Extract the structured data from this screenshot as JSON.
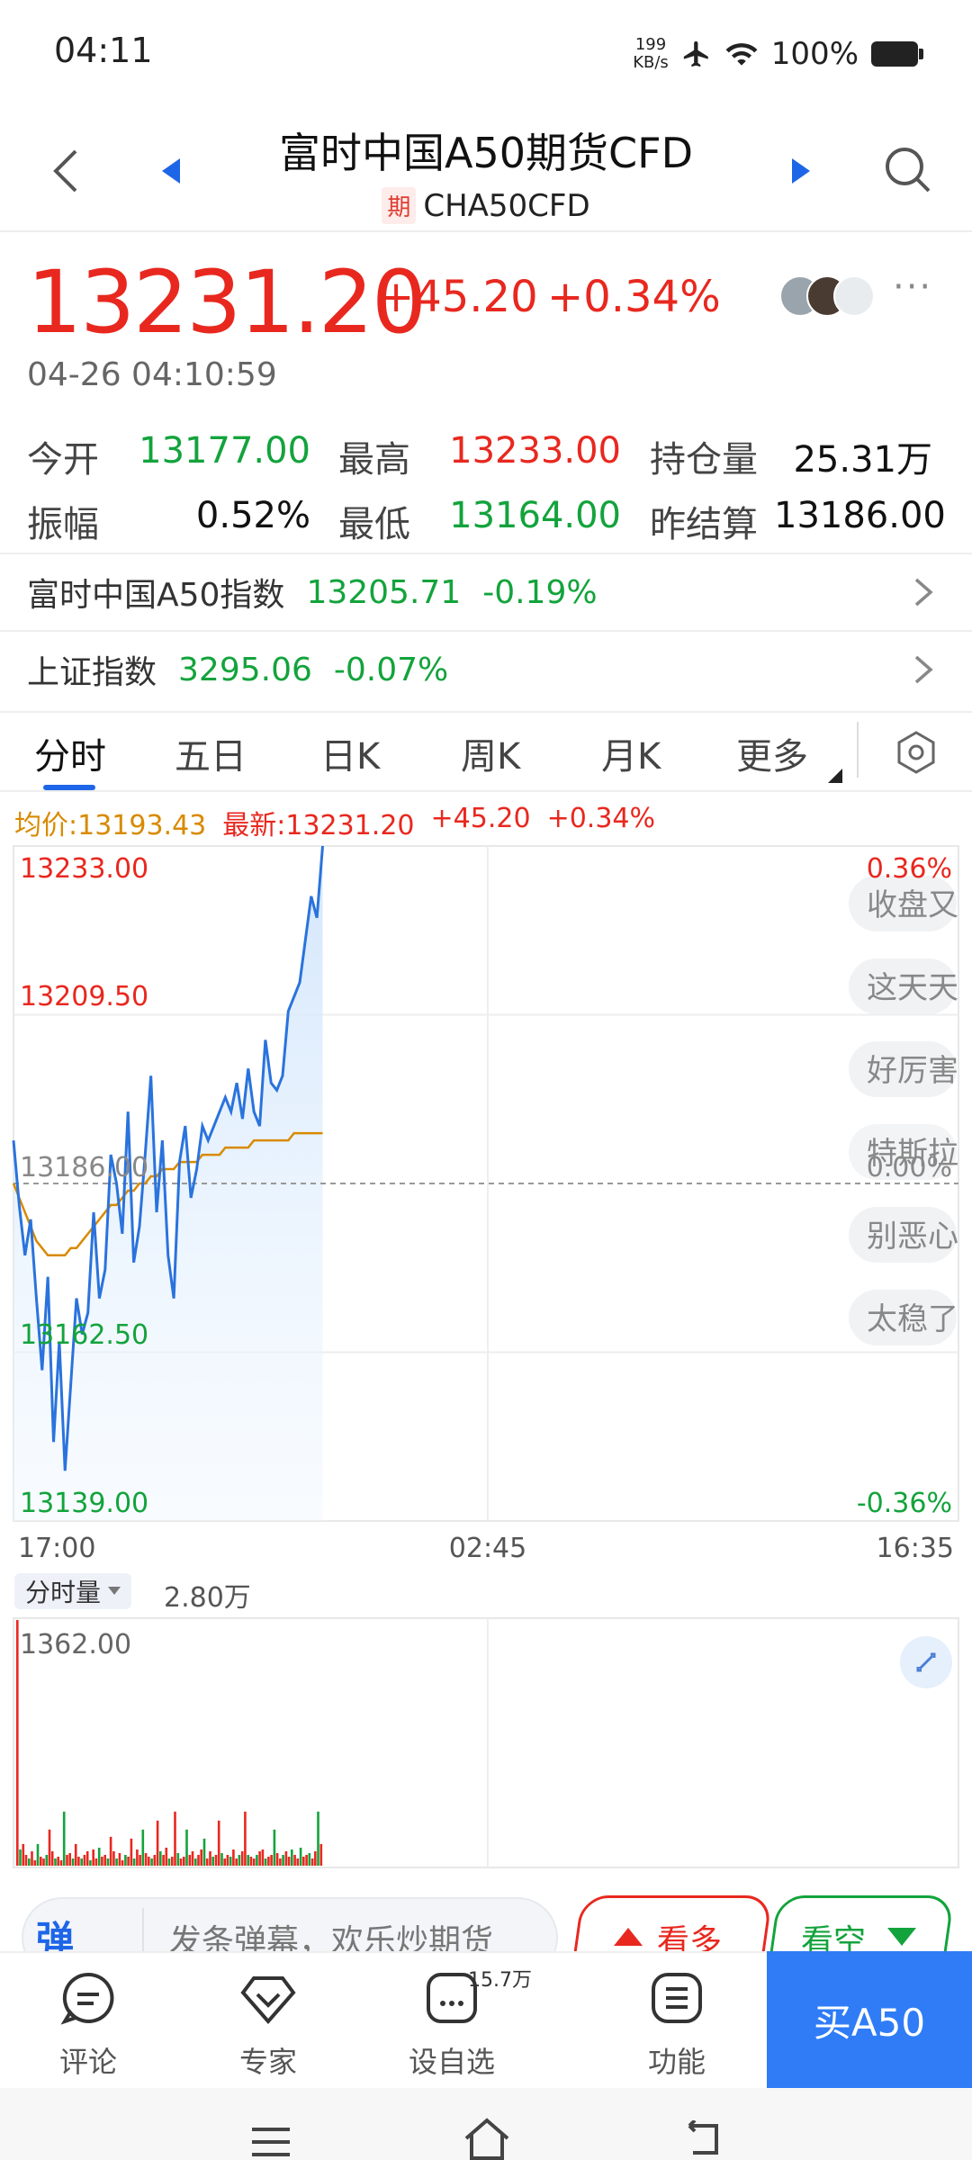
{
  "status": {
    "time": "04:11",
    "net_speed_value": "199",
    "net_speed_unit": "KB/s",
    "battery": "100%"
  },
  "header": {
    "title": "富时中国A50期货CFD",
    "badge": "期",
    "code": "CHA50CFD"
  },
  "quote": {
    "price": "13231.20",
    "change": "+45.20",
    "change_pct": "+0.34%",
    "time": "04-26 04:10:59",
    "more": "···"
  },
  "stats": [
    {
      "label": "今开",
      "value": "13177.00",
      "color": "green"
    },
    {
      "label": "最高",
      "value": "13233.00",
      "color": "red"
    },
    {
      "label": "持仓量",
      "value": "25.31万",
      "color": "black"
    },
    {
      "label": "振幅",
      "value": "0.52%",
      "color": "black"
    },
    {
      "label": "最低",
      "value": "13164.00",
      "color": "green"
    },
    {
      "label": "昨结算",
      "value": "13186.00",
      "color": "black"
    }
  ],
  "indices": [
    {
      "name": "富时中国A50指数",
      "value": "13205.71",
      "pct": "-0.19%"
    },
    {
      "name": "上证指数",
      "value": "3295.06",
      "pct": "-0.07%"
    }
  ],
  "tabs": [
    {
      "label": "分时"
    },
    {
      "label": "五日"
    },
    {
      "label": "日K"
    },
    {
      "label": "周K"
    },
    {
      "label": "月K"
    },
    {
      "label": "更多"
    }
  ],
  "chart_info": {
    "avg": "均价:13193.43",
    "latest": "最新:13231.20",
    "change": "+45.20",
    "pct": "+0.34%"
  },
  "chart_data": {
    "type": "line",
    "y_ticks": [
      "13233.00",
      "13209.50",
      "13186.00",
      "13162.50",
      "13139.00"
    ],
    "pct_ticks": [
      "0.36%",
      "0.00%",
      "-0.36%"
    ],
    "x_ticks": [
      "17:00",
      "02:45",
      "16:35"
    ],
    "ylim": [
      13139,
      13233
    ],
    "reference": 13186,
    "price": [
      13192,
      13183,
      13176,
      13181,
      13170,
      13160,
      13173,
      13150,
      13164,
      13146,
      13158,
      13170,
      13165,
      13168,
      13182,
      13170,
      13174,
      13190,
      13186,
      13179,
      13196,
      13175,
      13180,
      13190,
      13201,
      13182,
      13192,
      13176,
      13170,
      13189,
      13194,
      13184,
      13188,
      13194,
      13192,
      13194,
      13196,
      13198,
      13196,
      13200,
      13195,
      13202,
      13196,
      13194,
      13206,
      13200,
      13199,
      13201,
      13210,
      13212,
      13214,
      13220,
      13226,
      13223,
      13233
    ],
    "avg": [
      13186,
      13184,
      13182,
      13180,
      13178,
      13177,
      13176,
      13176,
      13176,
      13176,
      13177,
      13177,
      13178,
      13179,
      13180,
      13181,
      13182,
      13183,
      13183,
      13184,
      13185,
      13185,
      13186,
      13186,
      13187,
      13187,
      13188,
      13188,
      13188,
      13189,
      13189,
      13189,
      13189,
      13190,
      13190,
      13190,
      13190,
      13191,
      13191,
      13191,
      13191,
      13191,
      13192,
      13192,
      13192,
      13192,
      13192,
      13192,
      13192,
      13193,
      13193,
      13193,
      13193,
      13193,
      13193
    ],
    "danmaku": [
      "收盘又",
      "这天天",
      "好厉害",
      "特斯拉",
      "别恶心",
      "太稳了"
    ]
  },
  "volume": {
    "selector": "分时量",
    "total": "2.80万",
    "max_label": "1362.00",
    "bars": [
      1362,
      90,
      120,
      60,
      40,
      80,
      30,
      120,
      50,
      40,
      60,
      200,
      80,
      40,
      50,
      30,
      300,
      60,
      70,
      40,
      120,
      50,
      40,
      60,
      80,
      30,
      90,
      40,
      100,
      50,
      60,
      40,
      160,
      80,
      40,
      70,
      30,
      60,
      50,
      150,
      40,
      90,
      60,
      200,
      70,
      50,
      40,
      60,
      250,
      80,
      60,
      100,
      40,
      50,
      300,
      70,
      40,
      50,
      200,
      60,
      80,
      40,
      60,
      90,
      150,
      40,
      80,
      50,
      60,
      250,
      70,
      40,
      60,
      50,
      90,
      40,
      60,
      80,
      300,
      60,
      50,
      40,
      60,
      80,
      90,
      40,
      50,
      60,
      200,
      70,
      40,
      60,
      80,
      50,
      90,
      60,
      40,
      100,
      50,
      60,
      70,
      40,
      80,
      300,
      120
    ]
  },
  "danmu": {
    "toggle": "弹",
    "placeholder": "发条弹幕，欢乐炒期货",
    "bull": "看多",
    "bear": "看空"
  },
  "bottom": {
    "items": [
      {
        "label": "评论"
      },
      {
        "label": "专家"
      },
      {
        "label": "设自选"
      },
      {
        "label": "功能"
      }
    ],
    "watch_count": "15.7万",
    "buy": "买A50"
  },
  "colors": {
    "up": "#e8281f",
    "down": "#13a33c",
    "accent": "#2f7cf6",
    "avg_line": "#d88a00",
    "price_line": "#2a73dd"
  }
}
